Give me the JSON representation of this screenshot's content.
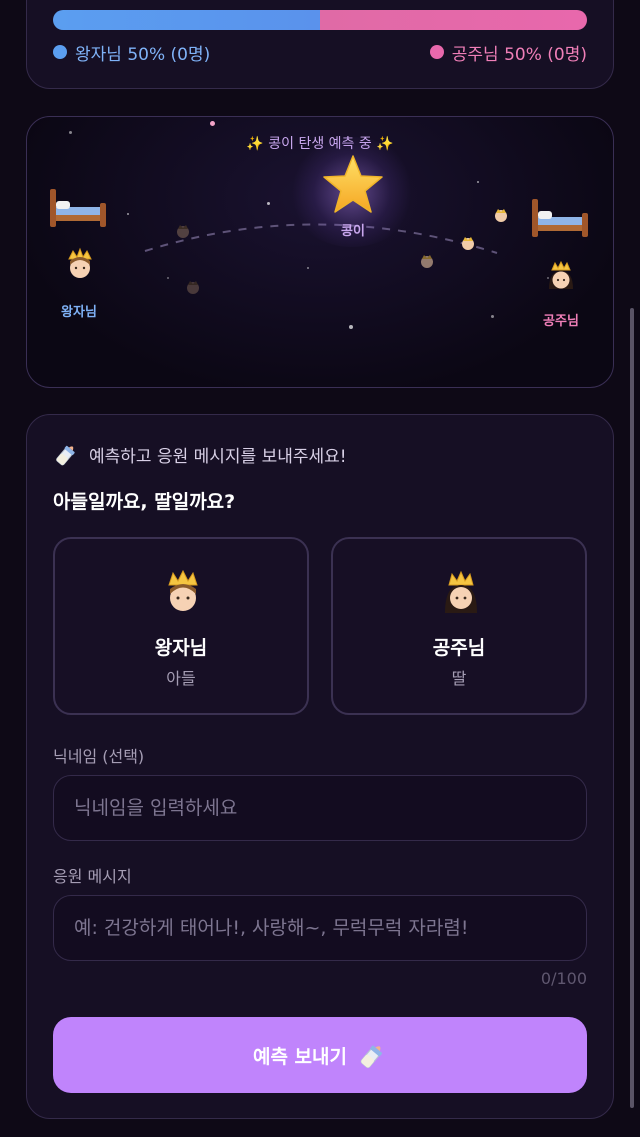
{
  "stats": {
    "boy_percent": 50,
    "girl_percent": 50,
    "boy_legend": "왕자님 50% (0명)",
    "girl_legend": "공주님 50% (0명)",
    "colors": {
      "boy": "#5b9ef0",
      "girl": "#e868ac"
    }
  },
  "sky": {
    "caption": "✨ 콩이 탄생 예측 중 ✨",
    "star_label": "콩이",
    "boy_label": "왕자님",
    "girl_label": "공주님",
    "icons": [
      "bed-icon",
      "prince-icon",
      "princess-icon",
      "star-icon"
    ]
  },
  "form": {
    "header": "예측하고 응원 메시지를 보내주세요!",
    "question": "아들일까요, 딸일까요?",
    "choices": [
      {
        "title": "왕자님",
        "sub": "아들",
        "icon": "prince-icon"
      },
      {
        "title": "공주님",
        "sub": "딸",
        "icon": "princess-icon"
      }
    ],
    "nickname_label": "닉네임 (선택)",
    "nickname_placeholder": "닉네임을 입력하세요",
    "nickname_value": "",
    "message_label": "응원 메시지",
    "message_placeholder": "예: 건강하게 태어나!, 사랑해~, 무럭무럭 자라렴!",
    "message_value": "",
    "counter": "0/100",
    "submit_label": "예측 보내기",
    "accent": "#c084fc"
  }
}
